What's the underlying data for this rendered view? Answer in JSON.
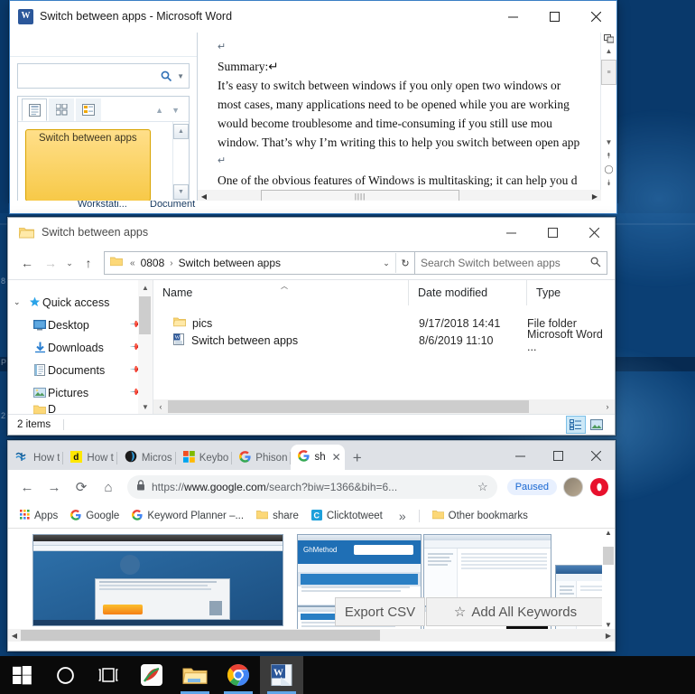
{
  "desktop": {
    "wallpaper_color": "#0b3f74",
    "icon_fragments": [
      "8",
      "P",
      "2"
    ]
  },
  "word_window": {
    "title": "Switch between apps - Microsoft Word",
    "app_icon": "word-icon",
    "logo_letter": "W",
    "controls": {
      "minimize": "minimize-icon",
      "maximize": "maximize-icon",
      "close": "close-icon"
    },
    "navigation_pane": {
      "search_placeholder": "",
      "search_icon": "search-icon",
      "dropdown_icon": "chevron-down-icon",
      "tabs": [
        {
          "name": "headings-tab",
          "icon": "headings-icon",
          "active": true
        },
        {
          "name": "pages-tab",
          "icon": "pages-thumbnail-icon",
          "active": false
        },
        {
          "name": "results-tab",
          "icon": "search-results-icon",
          "active": false
        }
      ],
      "prev_icon": "up-arrow-icon",
      "next_icon": "down-arrow-icon",
      "headings": [
        "Switch between apps"
      ],
      "scroll_up": "scroll-up-icon",
      "scroll_down": "scroll-down-icon"
    },
    "document": {
      "paragraphs": [
        "↵",
        "Summary:↵",
        "It’s easy to switch between windows if you only open two windows or",
        "most cases, many applications need to be opened while you are working",
        "would become troublesome and time-consuming if you still use mou",
        "window. That’s why I’m writing this to help you switch between open app",
        "↵",
        "One of the obvious features of Windows is multitasking; it can help you d"
      ],
      "scroll": {
        "split_icon": "split-window-icon",
        "up": "scroll-up-icon",
        "thumb": "scroll-thumb",
        "down": "scroll-down-icon",
        "prev_page": "previous-page-icon",
        "select_browse": "select-browse-object-icon",
        "next_page": "next-page-icon",
        "h_left": "scroll-left-icon",
        "h_right": "scroll-right-icon",
        "h_thumb_glyph": "||||"
      }
    },
    "status_fragments": [
      "Workstati...",
      "Document"
    ]
  },
  "explorer_window": {
    "title": "Switch between apps",
    "folder_icon": "folder-icon",
    "controls": {
      "minimize": "minimize-icon",
      "maximize": "maximize-icon",
      "close": "close-icon"
    },
    "toolbar": {
      "back": "back-arrow-icon",
      "forward": "forward-arrow-icon",
      "recent": "chevron-down-icon",
      "up": "up-arrow-icon",
      "refresh": "refresh-icon",
      "address_dropdown": "chevron-down-icon"
    },
    "breadcrumb": {
      "icon": "folder-icon",
      "overflow": "«",
      "items": [
        "0808",
        "Switch between apps"
      ],
      "separator": "›"
    },
    "search": {
      "placeholder": "Search Switch between apps",
      "icon": "search-icon"
    },
    "nav_pane": [
      {
        "label": "Quick access",
        "icon": "star-icon",
        "expand": "chevron-down-icon",
        "pinned": false,
        "indent": 0
      },
      {
        "label": "Desktop",
        "icon": "desktop-icon",
        "pinned": true,
        "indent": 1
      },
      {
        "label": "Downloads",
        "icon": "downloads-icon",
        "pinned": true,
        "indent": 1
      },
      {
        "label": "Documents",
        "icon": "documents-icon",
        "pinned": true,
        "indent": 1
      },
      {
        "label": "Pictures",
        "icon": "pictures-icon",
        "pinned": true,
        "indent": 1
      },
      {
        "label": "D",
        "icon": "folder-icon",
        "pinned": false,
        "indent": 1
      }
    ],
    "columns": [
      "Name",
      "Date modified",
      "Type"
    ],
    "sort_indicator": "sort-ascending-icon",
    "files": [
      {
        "name": "pics",
        "date": "9/17/2018 14:41",
        "type": "File folder",
        "icon": "folder-icon"
      },
      {
        "name": "Switch between apps",
        "date": "8/6/2019 11:10",
        "type": "Microsoft Word ...",
        "icon": "word-doc-icon"
      }
    ],
    "status": "2 items",
    "view_buttons": [
      {
        "name": "details-view-button",
        "icon": "details-view-icon",
        "selected": true
      },
      {
        "name": "large-icons-view-button",
        "icon": "large-icons-view-icon",
        "selected": false
      }
    ],
    "h_scroll": {
      "left": "scroll-left-icon",
      "right": "scroll-right-icon"
    }
  },
  "chrome_window": {
    "controls": {
      "minimize": "minimize-icon",
      "maximize": "maximize-icon",
      "close": "close-icon"
    },
    "tabs": [
      {
        "label": "How t",
        "favicon": "wikihow-icon",
        "active": false
      },
      {
        "label": "How t",
        "favicon": "digitalcitizen-icon",
        "active": false
      },
      {
        "label": "Micros",
        "favicon": "microsoft-edge-icon",
        "active": false
      },
      {
        "label": "Keybo",
        "favicon": "windows-icon",
        "active": false
      },
      {
        "label": "Phison",
        "favicon": "google-icon",
        "active": false
      },
      {
        "label": "sh",
        "favicon": "google-icon",
        "active": true,
        "close": "close-icon"
      }
    ],
    "new_tab": {
      "label": "+",
      "name": "new-tab-button"
    },
    "toolbar": {
      "back": "back-arrow-icon",
      "forward": "forward-arrow-icon",
      "reload": "reload-icon",
      "home": "home-icon",
      "lock": "lock-icon",
      "url_scheme": "https://",
      "url_host": "www.google.com",
      "url_path": "/search?biw=1366&bih=6...",
      "url_full": "https://www.google.com/search?biw=1366&bih=6...",
      "bookmark_star": "star-icon",
      "paused_label": "Paused",
      "avatar": "avatar-icon",
      "extension": "opera-extension-icon"
    },
    "bookmarks": [
      {
        "label": "Apps",
        "icon": "apps-grid-icon"
      },
      {
        "label": "Google",
        "icon": "google-icon"
      },
      {
        "label": "Keyword Planner –...",
        "icon": "google-icon"
      },
      {
        "label": "share",
        "icon": "folder-icon"
      },
      {
        "label": "Clicktotweet",
        "icon": "clicktotweet-icon"
      },
      {
        "label": "»",
        "icon": "overflow-icon"
      },
      {
        "label": "Other bookmarks",
        "icon": "folder-icon"
      }
    ],
    "content": {
      "overlay_buttons": [
        {
          "label": "Export CSV",
          "icon": null
        },
        {
          "label": "Add All Keywords",
          "icon": "star-icon"
        }
      ],
      "scroll": {
        "up": "scroll-up-icon",
        "down": "scroll-down-icon",
        "left": "scroll-left-icon",
        "right": "scroll-right-icon"
      }
    }
  },
  "taskbar": {
    "items": [
      {
        "name": "start-button",
        "icon": "windows-logo-icon",
        "active": false
      },
      {
        "name": "cortana-search-button",
        "icon": "circle-icon",
        "active": false
      },
      {
        "name": "task-view-button",
        "icon": "task-view-icon",
        "active": false
      },
      {
        "name": "snagit-button",
        "icon": "snagit-icon",
        "active": false,
        "running": false
      },
      {
        "name": "file-explorer-button",
        "icon": "folder-icon",
        "active": false,
        "running": true
      },
      {
        "name": "chrome-button",
        "icon": "chrome-icon",
        "active": false,
        "running": true
      },
      {
        "name": "word-button",
        "icon": "word-icon",
        "active": true,
        "running": true
      }
    ]
  }
}
